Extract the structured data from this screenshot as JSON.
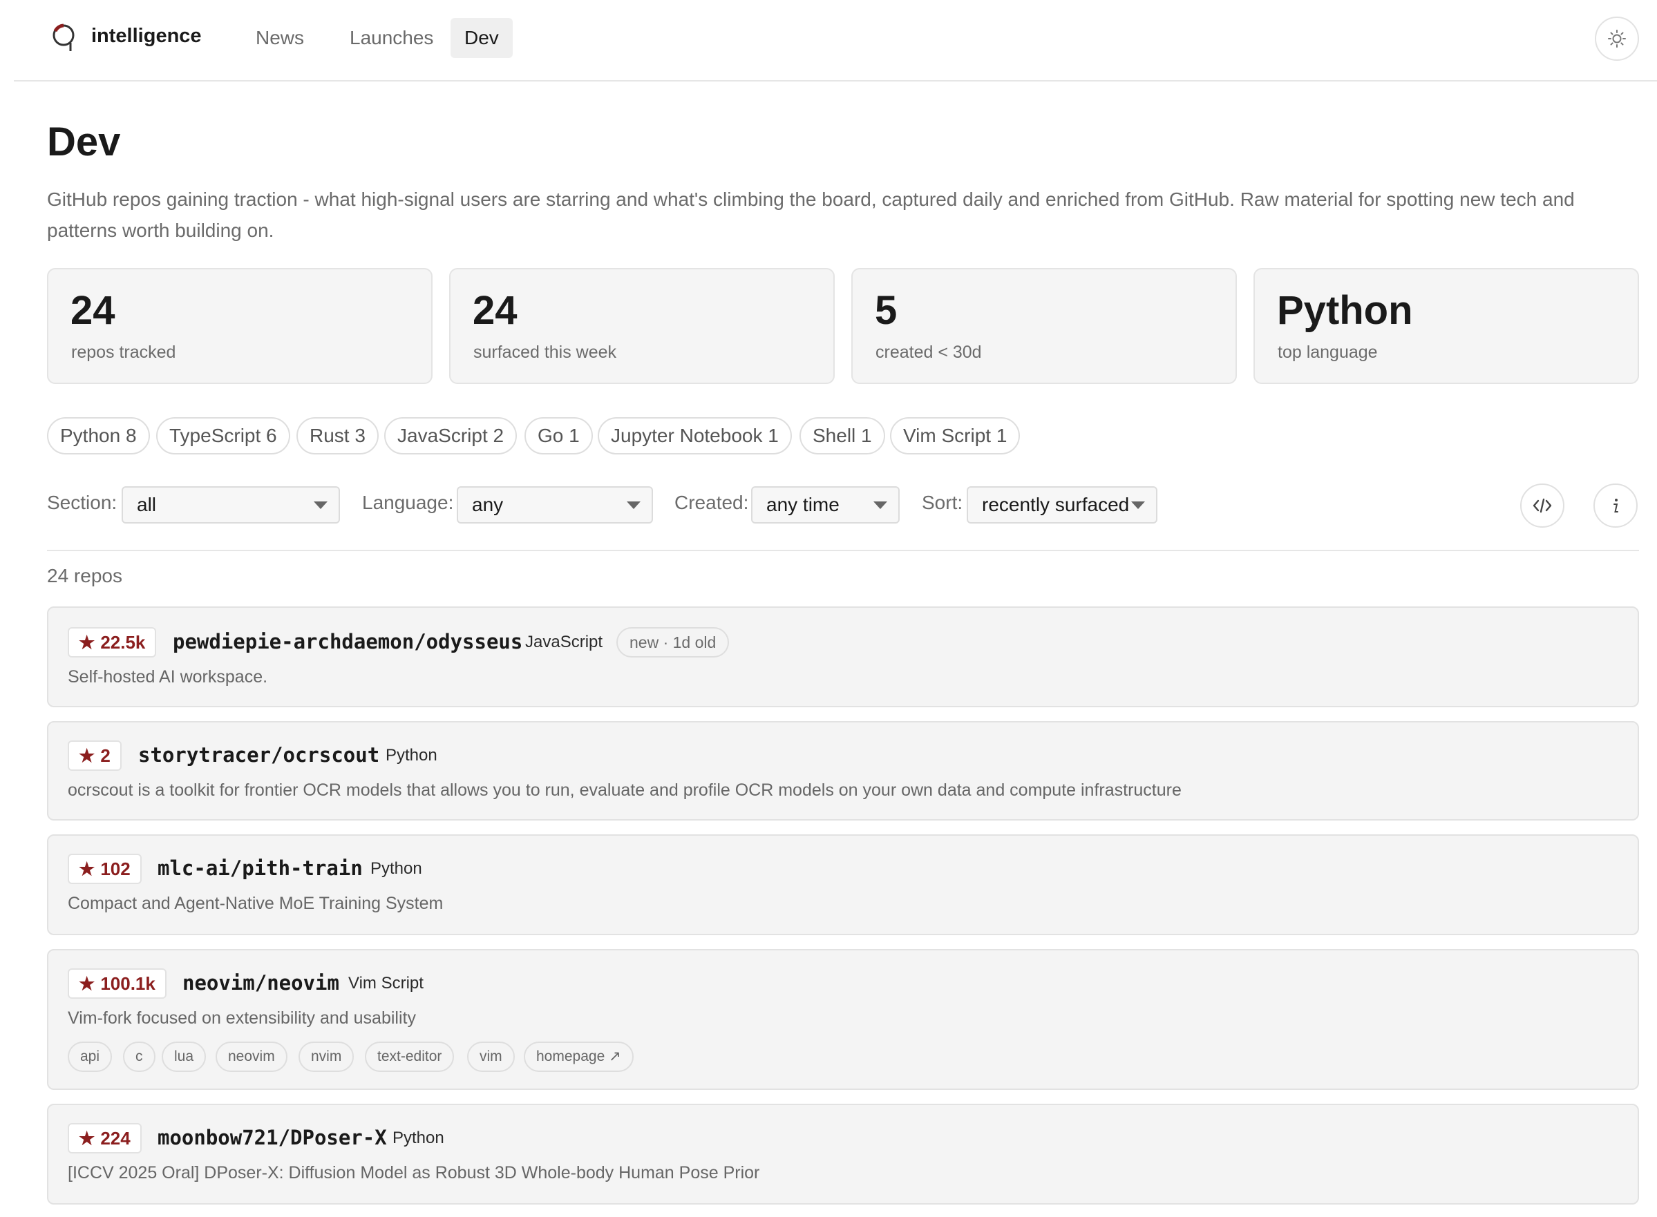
{
  "header": {
    "brand": "intelligence",
    "nav": [
      "News",
      "Launches",
      "Dev"
    ],
    "active": "Dev"
  },
  "page": {
    "title": "Dev",
    "description": "GitHub repos gaining traction - what high-signal users are starring and what's climbing the board, captured daily and enriched from GitHub. Raw material for spotting new tech and patterns worth building on."
  },
  "stats": [
    {
      "value": "24",
      "label": "repos tracked"
    },
    {
      "value": "24",
      "label": "surfaced this week"
    },
    {
      "value": "5",
      "label": "created < 30d"
    },
    {
      "value": "Python",
      "label": "top language"
    }
  ],
  "language_chips": [
    "Python 8",
    "TypeScript 6",
    "Rust 3",
    "JavaScript 2",
    "Go 1",
    "Jupyter Notebook 1",
    "Shell 1",
    "Vim Script 1"
  ],
  "filters": {
    "section_label": "Section:",
    "section_value": "all",
    "language_label": "Language:",
    "language_value": "any",
    "created_label": "Created:",
    "created_value": "any time",
    "sort_label": "Sort:",
    "sort_value": "recently surfaced"
  },
  "repo_count": "24 repos",
  "repos": [
    {
      "stars": "22.5k",
      "name": "pewdiepie-archdaemon/odysseus",
      "language": "JavaScript",
      "badge": "new · 1d old",
      "description": "Self-hosted AI workspace."
    },
    {
      "stars": "2",
      "name": "storytracer/ocrscout",
      "language": "Python",
      "description": "ocrscout is a toolkit for frontier OCR models that allows you to run, evaluate and profile OCR models on your own data and compute infrastructure"
    },
    {
      "stars": "102",
      "name": "mlc-ai/pith-train",
      "language": "Python",
      "description": "Compact and Agent-Native MoE Training System"
    },
    {
      "stars": "100.1k",
      "name": "neovim/neovim",
      "language": "Vim Script",
      "description": "Vim-fork focused on extensibility and usability",
      "tags": [
        "api",
        "c",
        "lua",
        "neovim",
        "nvim",
        "text-editor",
        "vim",
        "homepage ↗"
      ]
    },
    {
      "stars": "224",
      "name": "moonbow721/DPoser-X",
      "language": "Python",
      "description": "[ICCV 2025 Oral] DPoser-X: Diffusion Model as Robust 3D Whole-body Human Pose Prior"
    }
  ],
  "colors": {
    "accent": "#8b1e1e",
    "card_bg": "#f4f4f4",
    "border": "#e2e2e2"
  }
}
